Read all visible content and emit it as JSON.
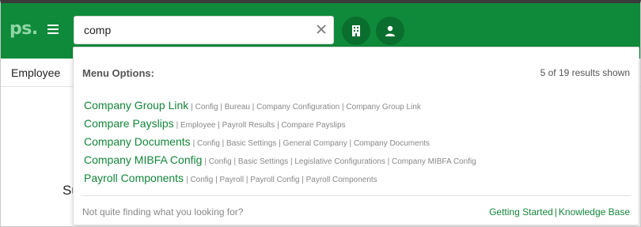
{
  "header": {
    "logo_text": "ps.",
    "search": {
      "value": "comp",
      "placeholder": ""
    }
  },
  "subbar": {
    "tab_label": "Employee"
  },
  "background": {
    "partial_text": "Su"
  },
  "dropdown": {
    "title": "Menu Options:",
    "count_text": "5 of 19 results shown",
    "results": [
      {
        "title": "Company Group Link",
        "path": "| Config | Bureau | Company Configuration | Company Group Link"
      },
      {
        "title": "Compare Payslips",
        "path": "| Employee | Payroll Results | Compare Payslips"
      },
      {
        "title": "Company Documents",
        "path": "| Config | Basic Settings | General Company | Company Documents"
      },
      {
        "title": "Company MIBFA Config",
        "path": "| Config | Basic Settings | Legislative Configurations | Company MIBFA Config"
      },
      {
        "title": "Payroll Components",
        "path": "| Config | Payroll | Payroll Config | Payroll Components"
      }
    ],
    "footer_question": "Not quite finding what you looking for?",
    "links": {
      "getting_started": "Getting Started",
      "separator": "|",
      "knowledge_base": "Knowledge Base"
    }
  },
  "icons": {
    "menu": "hamburger-icon",
    "clear": "close-icon",
    "company": "building-icon",
    "profile": "user-icon"
  },
  "colors": {
    "brand_green": "#0f8a3a",
    "link_green": "#13853a",
    "button_green": "#0a6e2e"
  }
}
